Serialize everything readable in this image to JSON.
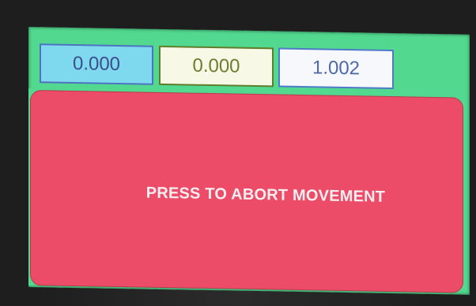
{
  "coordinates": {
    "x_value": "0.000",
    "y_value": "0.000",
    "z_value": "1.002"
  },
  "abort_button": {
    "label": "PRESS TO ABORT MOVEMENT"
  },
  "colors": {
    "screen_background": "#52d98f",
    "abort_background": "#ec4c68",
    "x_box_background": "#7fd9ee",
    "y_box_background": "#f7f8e6",
    "z_box_background": "#f6f8fb"
  }
}
